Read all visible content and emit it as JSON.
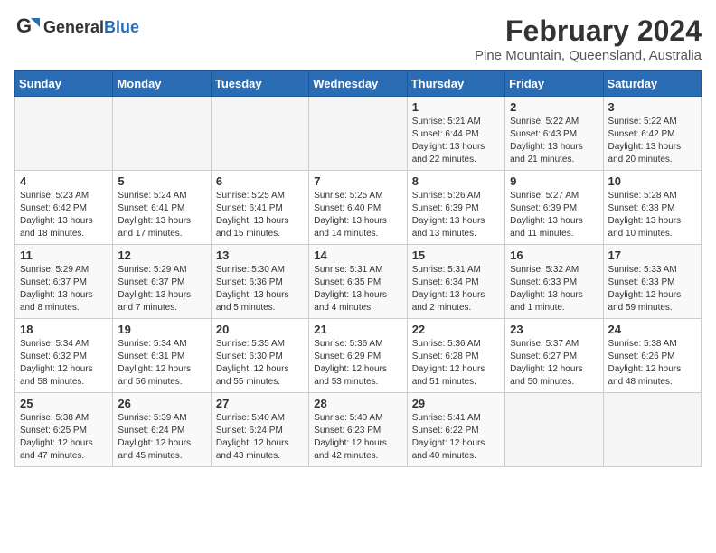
{
  "header": {
    "logo_general": "General",
    "logo_blue": "Blue",
    "month_title": "February 2024",
    "location": "Pine Mountain, Queensland, Australia"
  },
  "weekdays": [
    "Sunday",
    "Monday",
    "Tuesday",
    "Wednesday",
    "Thursday",
    "Friday",
    "Saturday"
  ],
  "weeks": [
    [
      {
        "day": "",
        "info": ""
      },
      {
        "day": "",
        "info": ""
      },
      {
        "day": "",
        "info": ""
      },
      {
        "day": "",
        "info": ""
      },
      {
        "day": "1",
        "info": "Sunrise: 5:21 AM\nSunset: 6:44 PM\nDaylight: 13 hours\nand 22 minutes."
      },
      {
        "day": "2",
        "info": "Sunrise: 5:22 AM\nSunset: 6:43 PM\nDaylight: 13 hours\nand 21 minutes."
      },
      {
        "day": "3",
        "info": "Sunrise: 5:22 AM\nSunset: 6:42 PM\nDaylight: 13 hours\nand 20 minutes."
      }
    ],
    [
      {
        "day": "4",
        "info": "Sunrise: 5:23 AM\nSunset: 6:42 PM\nDaylight: 13 hours\nand 18 minutes."
      },
      {
        "day": "5",
        "info": "Sunrise: 5:24 AM\nSunset: 6:41 PM\nDaylight: 13 hours\nand 17 minutes."
      },
      {
        "day": "6",
        "info": "Sunrise: 5:25 AM\nSunset: 6:41 PM\nDaylight: 13 hours\nand 15 minutes."
      },
      {
        "day": "7",
        "info": "Sunrise: 5:25 AM\nSunset: 6:40 PM\nDaylight: 13 hours\nand 14 minutes."
      },
      {
        "day": "8",
        "info": "Sunrise: 5:26 AM\nSunset: 6:39 PM\nDaylight: 13 hours\nand 13 minutes."
      },
      {
        "day": "9",
        "info": "Sunrise: 5:27 AM\nSunset: 6:39 PM\nDaylight: 13 hours\nand 11 minutes."
      },
      {
        "day": "10",
        "info": "Sunrise: 5:28 AM\nSunset: 6:38 PM\nDaylight: 13 hours\nand 10 minutes."
      }
    ],
    [
      {
        "day": "11",
        "info": "Sunrise: 5:29 AM\nSunset: 6:37 PM\nDaylight: 13 hours\nand 8 minutes."
      },
      {
        "day": "12",
        "info": "Sunrise: 5:29 AM\nSunset: 6:37 PM\nDaylight: 13 hours\nand 7 minutes."
      },
      {
        "day": "13",
        "info": "Sunrise: 5:30 AM\nSunset: 6:36 PM\nDaylight: 13 hours\nand 5 minutes."
      },
      {
        "day": "14",
        "info": "Sunrise: 5:31 AM\nSunset: 6:35 PM\nDaylight: 13 hours\nand 4 minutes."
      },
      {
        "day": "15",
        "info": "Sunrise: 5:31 AM\nSunset: 6:34 PM\nDaylight: 13 hours\nand 2 minutes."
      },
      {
        "day": "16",
        "info": "Sunrise: 5:32 AM\nSunset: 6:33 PM\nDaylight: 13 hours\nand 1 minute."
      },
      {
        "day": "17",
        "info": "Sunrise: 5:33 AM\nSunset: 6:33 PM\nDaylight: 12 hours\nand 59 minutes."
      }
    ],
    [
      {
        "day": "18",
        "info": "Sunrise: 5:34 AM\nSunset: 6:32 PM\nDaylight: 12 hours\nand 58 minutes."
      },
      {
        "day": "19",
        "info": "Sunrise: 5:34 AM\nSunset: 6:31 PM\nDaylight: 12 hours\nand 56 minutes."
      },
      {
        "day": "20",
        "info": "Sunrise: 5:35 AM\nSunset: 6:30 PM\nDaylight: 12 hours\nand 55 minutes."
      },
      {
        "day": "21",
        "info": "Sunrise: 5:36 AM\nSunset: 6:29 PM\nDaylight: 12 hours\nand 53 minutes."
      },
      {
        "day": "22",
        "info": "Sunrise: 5:36 AM\nSunset: 6:28 PM\nDaylight: 12 hours\nand 51 minutes."
      },
      {
        "day": "23",
        "info": "Sunrise: 5:37 AM\nSunset: 6:27 PM\nDaylight: 12 hours\nand 50 minutes."
      },
      {
        "day": "24",
        "info": "Sunrise: 5:38 AM\nSunset: 6:26 PM\nDaylight: 12 hours\nand 48 minutes."
      }
    ],
    [
      {
        "day": "25",
        "info": "Sunrise: 5:38 AM\nSunset: 6:25 PM\nDaylight: 12 hours\nand 47 minutes."
      },
      {
        "day": "26",
        "info": "Sunrise: 5:39 AM\nSunset: 6:24 PM\nDaylight: 12 hours\nand 45 minutes."
      },
      {
        "day": "27",
        "info": "Sunrise: 5:40 AM\nSunset: 6:24 PM\nDaylight: 12 hours\nand 43 minutes."
      },
      {
        "day": "28",
        "info": "Sunrise: 5:40 AM\nSunset: 6:23 PM\nDaylight: 12 hours\nand 42 minutes."
      },
      {
        "day": "29",
        "info": "Sunrise: 5:41 AM\nSunset: 6:22 PM\nDaylight: 12 hours\nand 40 minutes."
      },
      {
        "day": "",
        "info": ""
      },
      {
        "day": "",
        "info": ""
      }
    ]
  ]
}
